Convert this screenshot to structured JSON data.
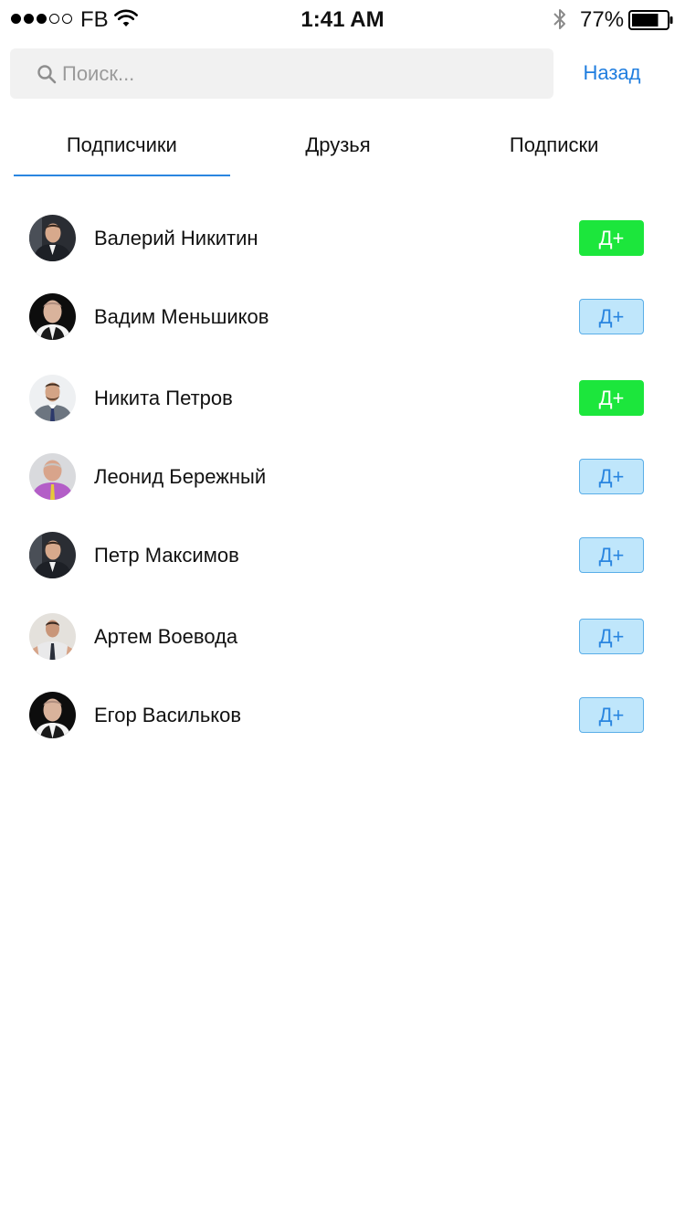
{
  "status_bar": {
    "carrier": "FB",
    "time": "1:41 AM",
    "battery_percent": "77%",
    "battery_level": 0.77,
    "signal_bars_filled": 3,
    "signal_bars_total": 5,
    "icons": [
      "wifi-icon",
      "bluetooth-icon",
      "battery-icon"
    ]
  },
  "search": {
    "placeholder": "Поиск...",
    "value": "",
    "icon": "search-icon"
  },
  "header": {
    "back_label": "Назад"
  },
  "tabs": [
    {
      "label": "Подписчики",
      "active": true
    },
    {
      "label": "Друзья",
      "active": false
    },
    {
      "label": "Подписки",
      "active": false
    }
  ],
  "users": [
    {
      "name": "Валерий Никитин",
      "button": {
        "label": "Д+",
        "style": "green"
      }
    },
    {
      "name": "Вадим Меньшиков",
      "button": {
        "label": "Д+",
        "style": "light"
      }
    },
    {
      "name": "Никита Петров",
      "button": {
        "label": "Д+",
        "style": "green"
      }
    },
    {
      "name": "Леонид Бережный",
      "button": {
        "label": "Д+",
        "style": "light"
      }
    },
    {
      "name": "Петр Максимов",
      "button": {
        "label": "Д+",
        "style": "light"
      }
    },
    {
      "name": "Артем Воевода",
      "button": {
        "label": "Д+",
        "style": "light"
      }
    },
    {
      "name": "Егор Васильков",
      "button": {
        "label": "Д+",
        "style": "light"
      }
    }
  ],
  "colors": {
    "accent": "#2a86e0",
    "link": "#1f7ddf",
    "green_button": "#1ce63c",
    "light_button_bg": "#bfe6fb",
    "light_button_border": "#5aaee8",
    "search_bg": "#f1f1f1"
  }
}
